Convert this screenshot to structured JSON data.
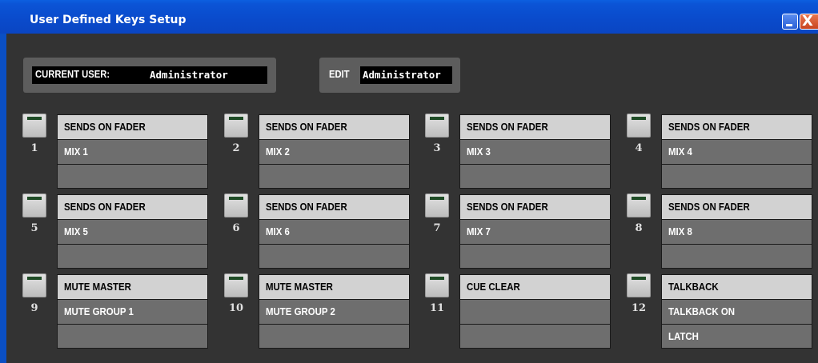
{
  "window": {
    "title": "User Defined Keys Setup",
    "minimize_label": "",
    "close_label": "X"
  },
  "current_user": {
    "label": "CURRENT USER:",
    "name": "Administrator"
  },
  "edit": {
    "label": "EDIT",
    "name": "Administrator"
  },
  "keys": [
    {
      "num": "1",
      "function": "SENDS ON FADER",
      "param1": "MIX 1",
      "param2": ""
    },
    {
      "num": "2",
      "function": "SENDS ON FADER",
      "param1": "MIX 2",
      "param2": ""
    },
    {
      "num": "3",
      "function": "SENDS ON FADER",
      "param1": "MIX 3",
      "param2": ""
    },
    {
      "num": "4",
      "function": "SENDS ON FADER",
      "param1": "MIX 4",
      "param2": ""
    },
    {
      "num": "5",
      "function": "SENDS ON FADER",
      "param1": "MIX 5",
      "param2": ""
    },
    {
      "num": "6",
      "function": "SENDS ON FADER",
      "param1": "MIX 6",
      "param2": ""
    },
    {
      "num": "7",
      "function": "SENDS ON FADER",
      "param1": "MIX 7",
      "param2": ""
    },
    {
      "num": "8",
      "function": "SENDS ON FADER",
      "param1": "MIX 8",
      "param2": ""
    },
    {
      "num": "9",
      "function": "MUTE MASTER",
      "param1": "MUTE GROUP 1",
      "param2": ""
    },
    {
      "num": "10",
      "function": "MUTE MASTER",
      "param1": "MUTE GROUP 2",
      "param2": ""
    },
    {
      "num": "11",
      "function": "CUE CLEAR",
      "param1": "",
      "param2": ""
    },
    {
      "num": "12",
      "function": "TALKBACK",
      "param1": "TALKBACK ON",
      "param2": "LATCH"
    }
  ],
  "colors": {
    "titlebar": "#0a4bcc",
    "client_background": "#333333",
    "function_row": "#d2d2d2",
    "param_row": "#6e6e6e",
    "display_background": "#000000"
  }
}
